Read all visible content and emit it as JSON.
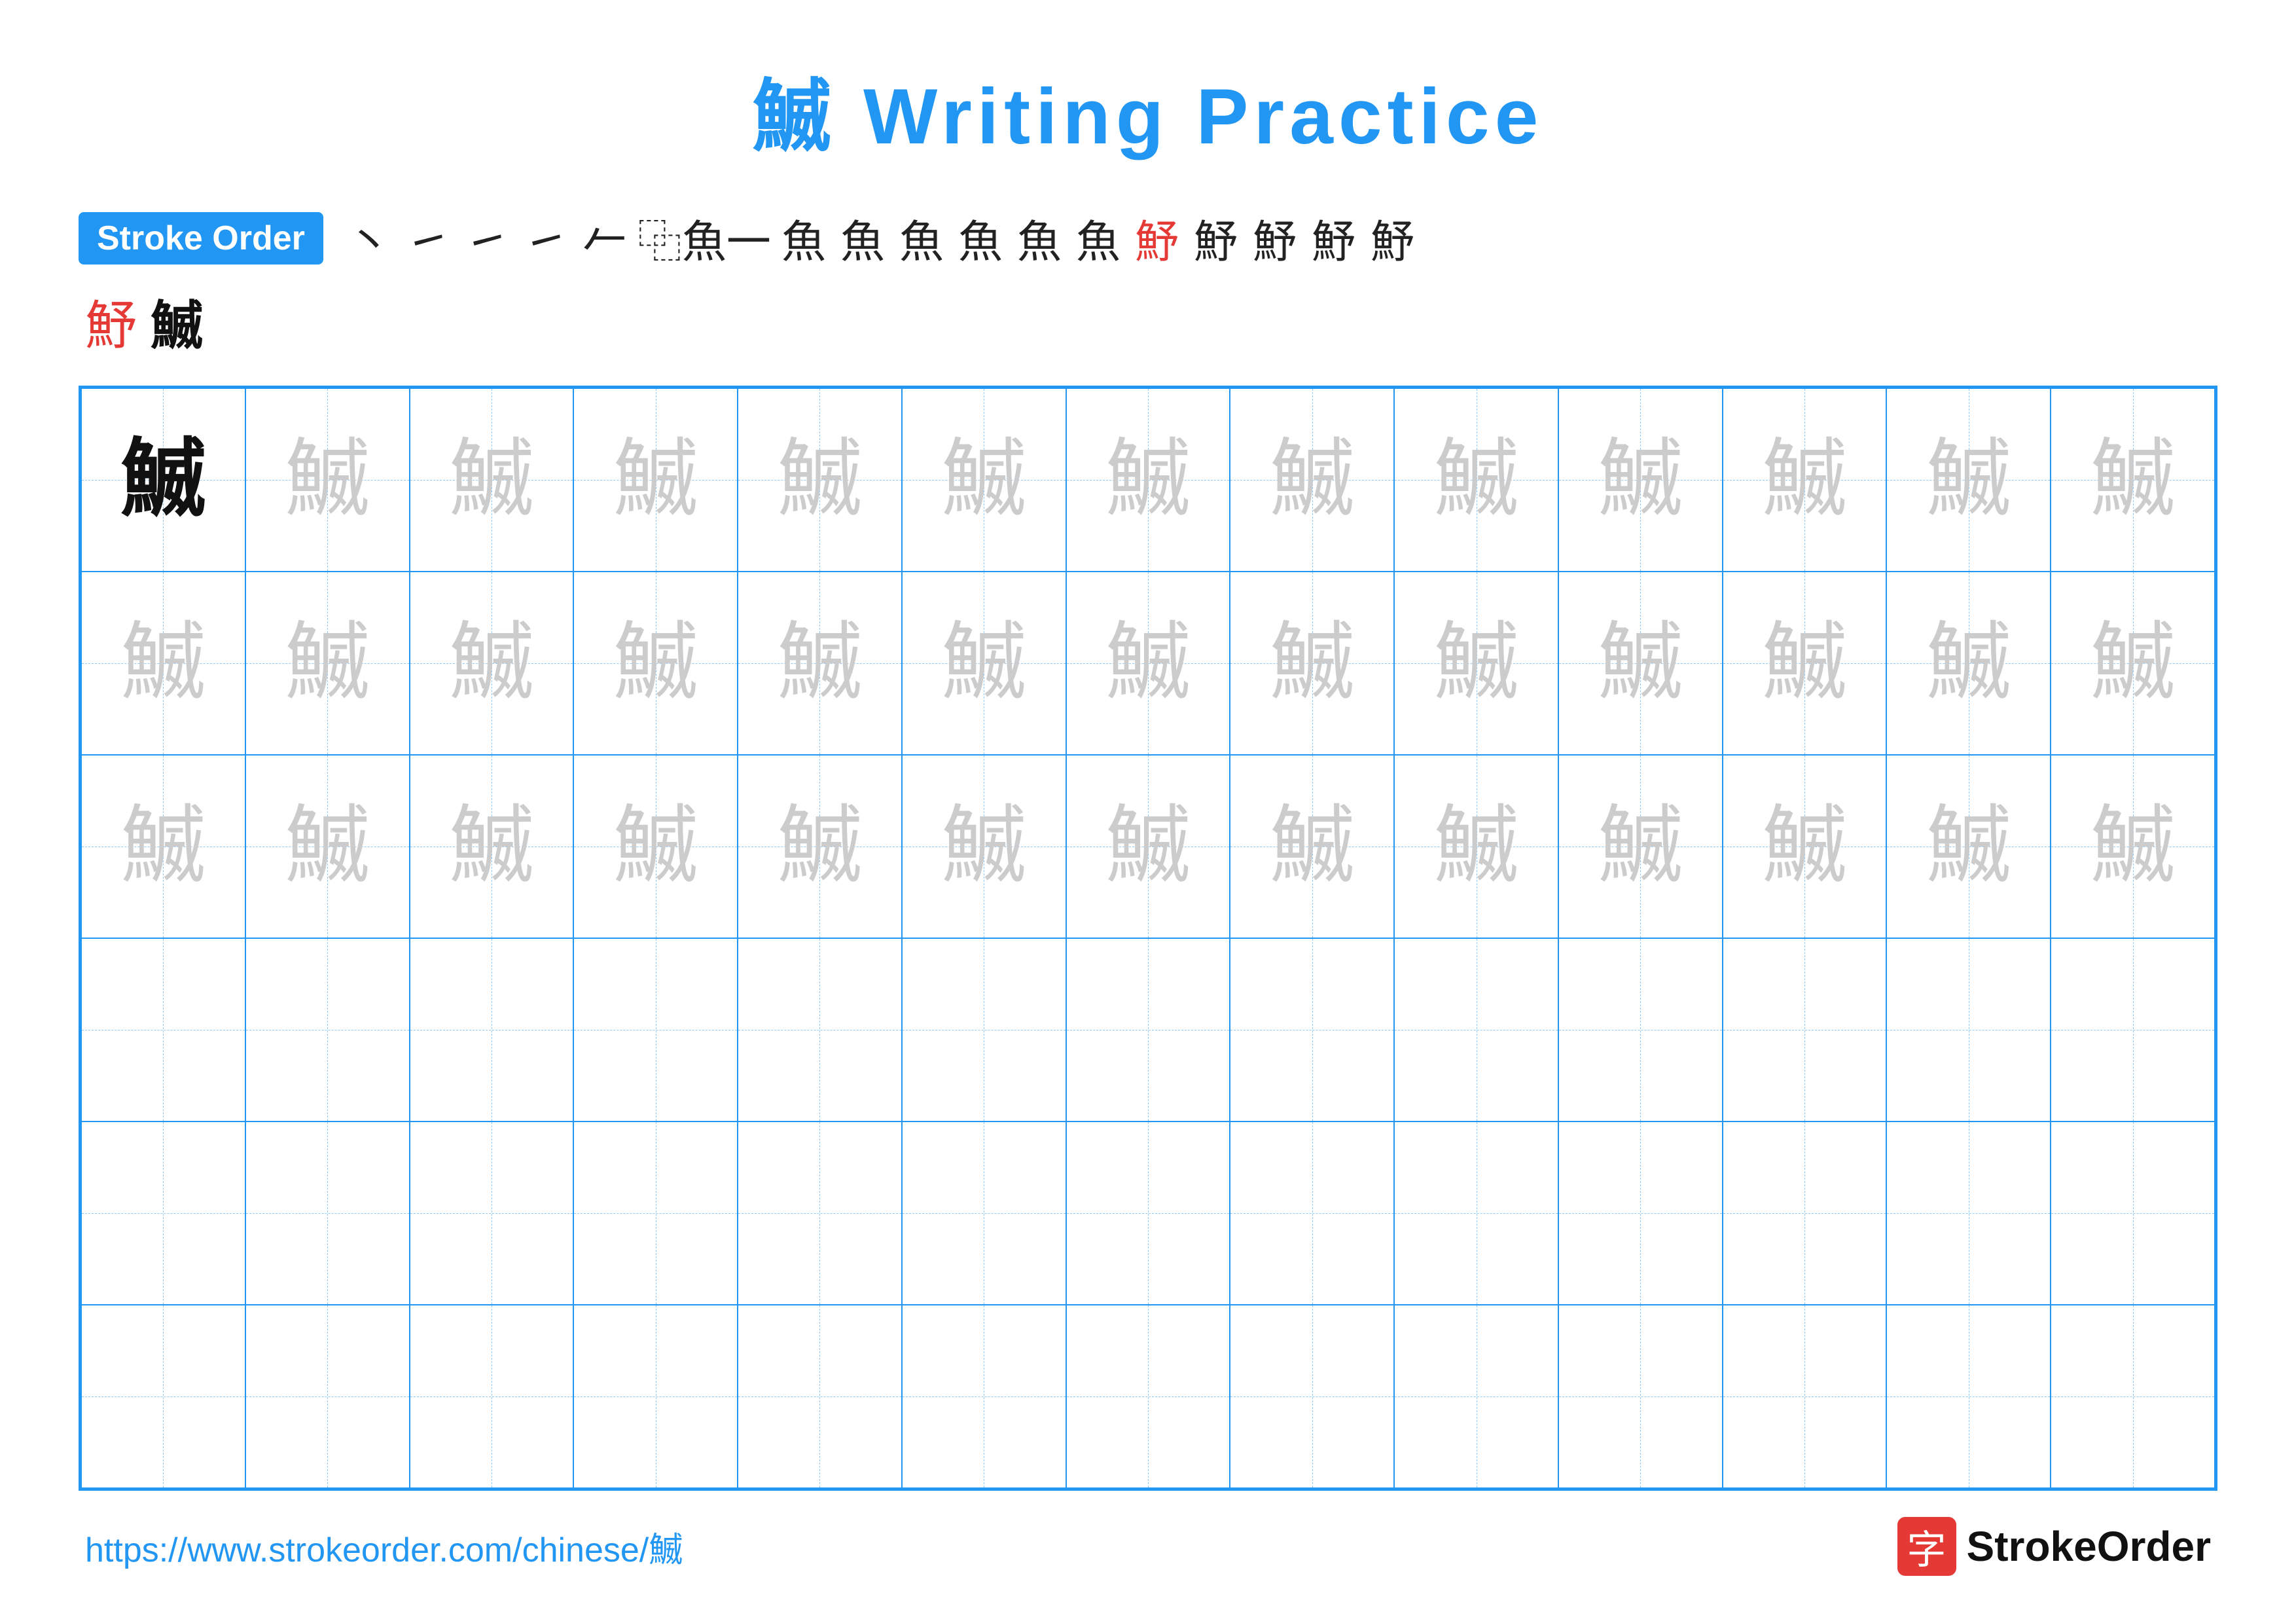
{
  "title": {
    "char": "鰄",
    "rest": " Writing Practice"
  },
  "stroke_order": {
    "badge_label": "Stroke Order",
    "strokes_row1": [
      "丶",
      "㇀",
      "㇀",
      "㇀",
      "𠂉",
      "魚",
      "魚",
      "魚",
      "魚",
      "魚",
      "魚",
      "魚",
      "魣",
      "魣",
      "魣",
      "魣",
      "魣"
    ],
    "strokes_row2_partial": "魣",
    "strokes_row2_full": "鰄",
    "red_index": 12
  },
  "grid": {
    "rows": 6,
    "cols": 13,
    "char": "鰄",
    "filled_rows": 3,
    "first_cell_dark": true
  },
  "footer": {
    "url": "https://www.strokeorder.com/chinese/鰄",
    "logo_char": "字",
    "logo_text": "StrokeOrder"
  }
}
